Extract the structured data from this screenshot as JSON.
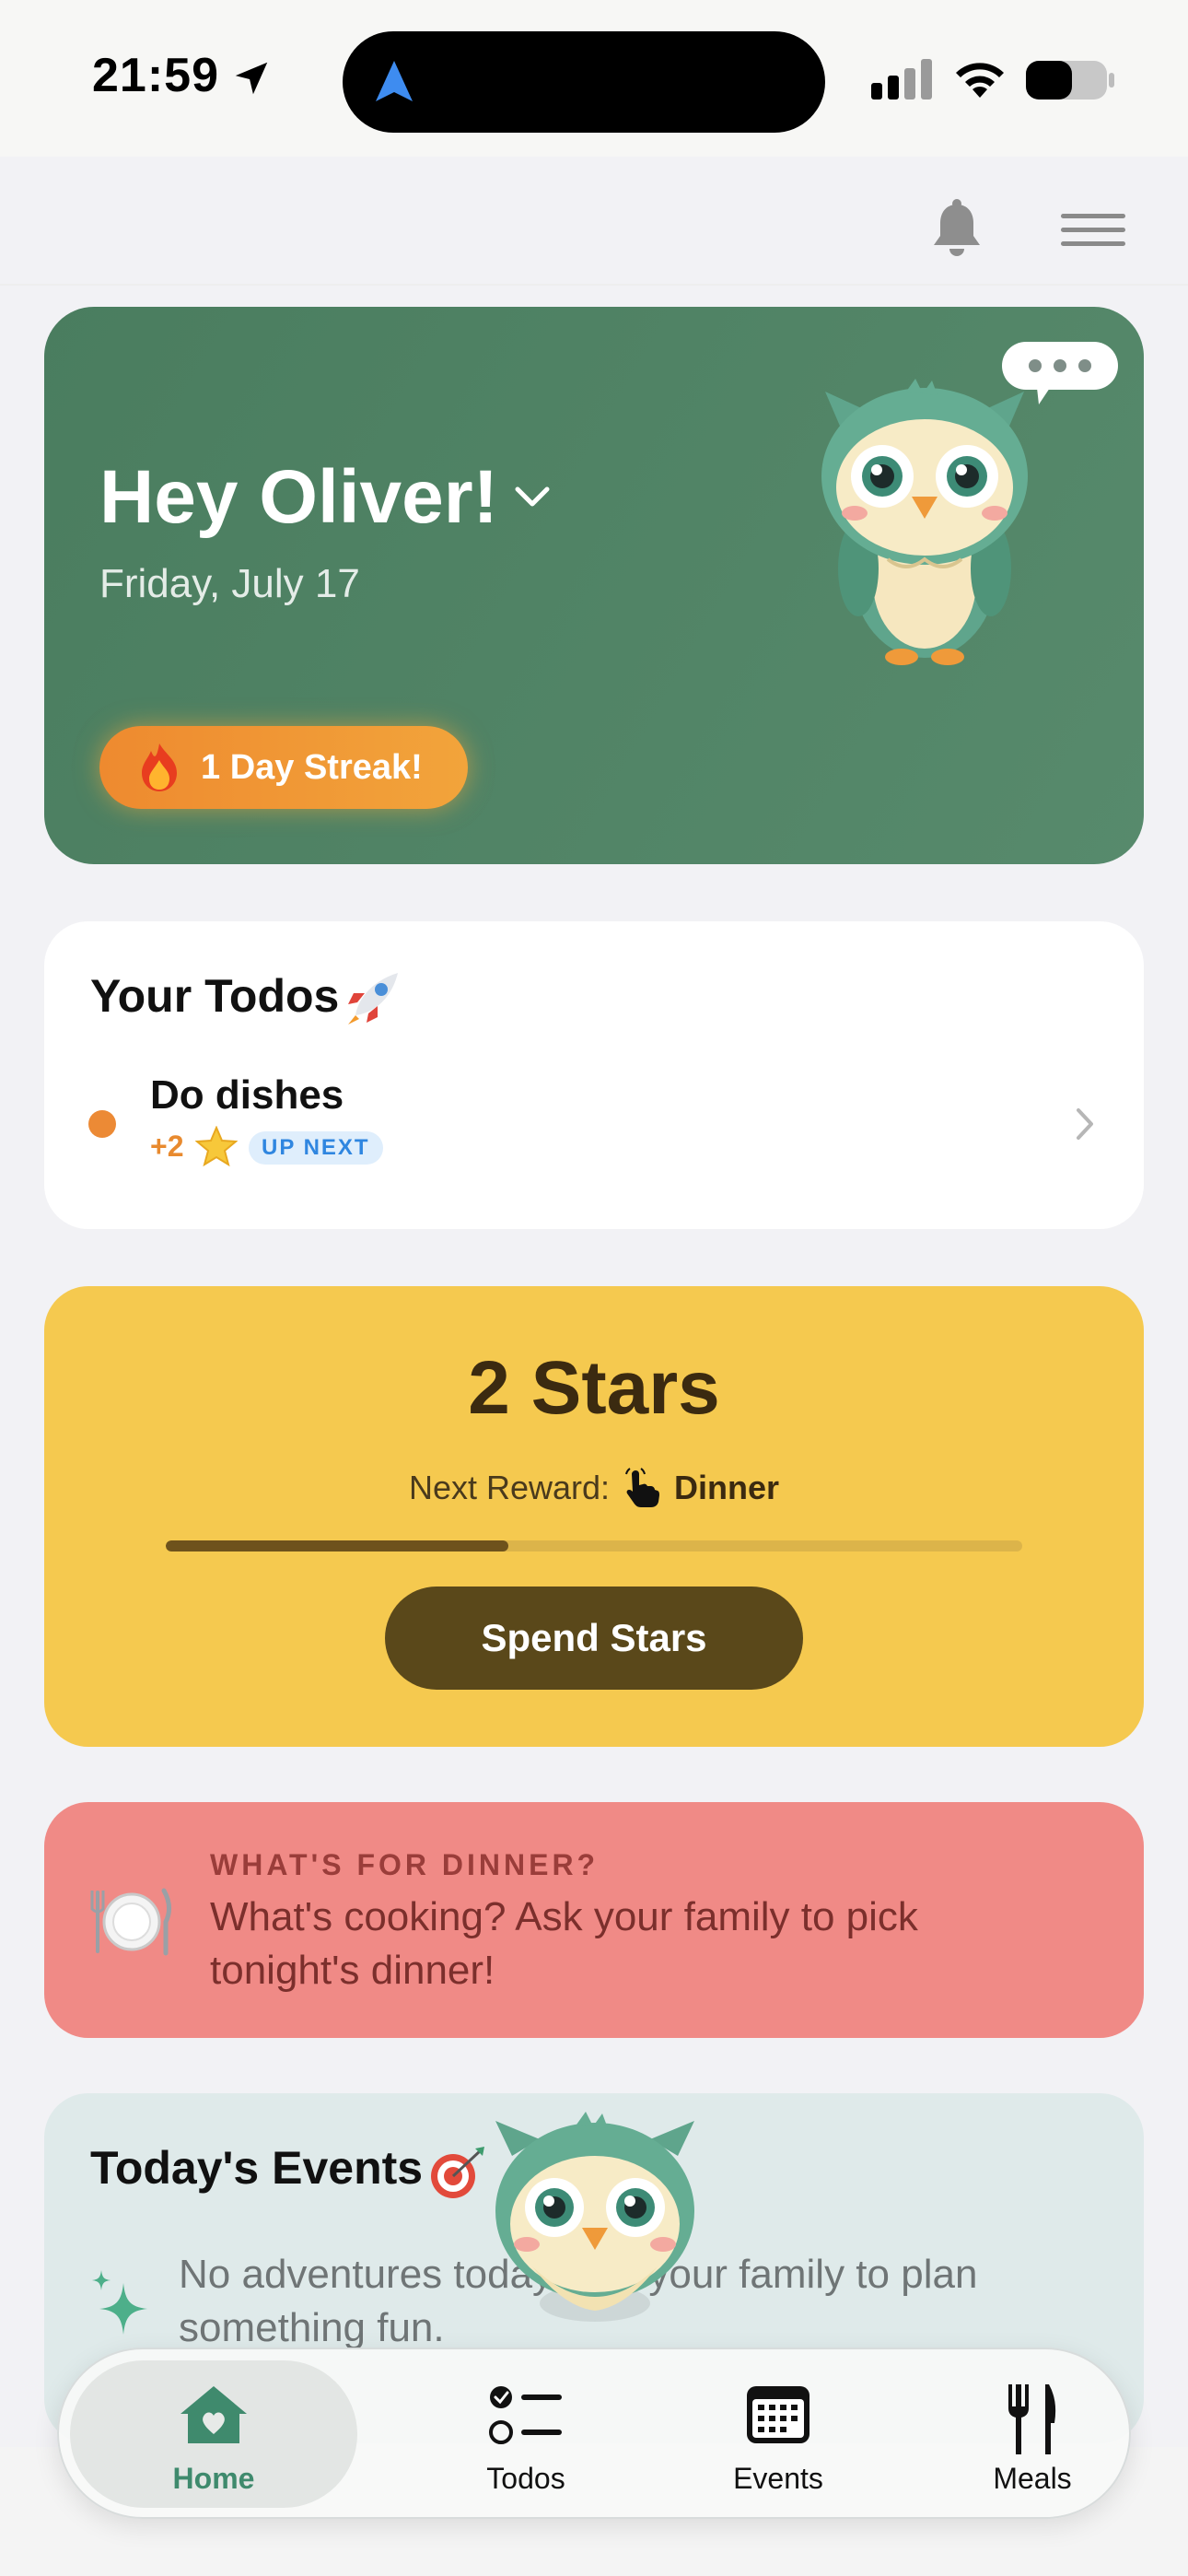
{
  "status_bar": {
    "time": "21:59",
    "icons": [
      "location-arrow-icon",
      "navigation-icon",
      "cellular-signal-icon",
      "wifi-icon",
      "battery-icon"
    ]
  },
  "header": {
    "icons": [
      "bell-icon",
      "menu-icon"
    ]
  },
  "hero": {
    "greeting": "Hey Oliver!",
    "date": "Friday, July 17",
    "streak": "1 Day Streak!",
    "colors": {
      "background": "#4a7d5f",
      "streak": "#ee8a2f"
    }
  },
  "todos": {
    "title": "Your Todos",
    "items": [
      {
        "name": "Do dishes",
        "points": "+2",
        "badge": "UP NEXT"
      }
    ]
  },
  "stars": {
    "count": "2 Stars",
    "next_reward_label": "Next Reward:",
    "next_reward": "Dinner",
    "progress_fraction": 0.4,
    "button": "Spend Stars",
    "colors": {
      "background": "#f5c94f",
      "button": "#5a481a"
    }
  },
  "dinner": {
    "kicker": "WHAT'S FOR DINNER?",
    "text": "What's cooking? Ask your family to pick tonight's dinner!",
    "colors": {
      "background": "#f08a86"
    }
  },
  "events": {
    "title": "Today's Events",
    "text": "No adventures today. Ask your family to plan something fun."
  },
  "tabs": [
    {
      "label": "Home",
      "icon": "home-heart-icon",
      "active": true
    },
    {
      "label": "Todos",
      "icon": "checklist-icon",
      "active": false
    },
    {
      "label": "Events",
      "icon": "calendar-icon",
      "active": false
    },
    {
      "label": "Meals",
      "icon": "fork-knife-icon",
      "active": false
    }
  ],
  "accent_color": "#3f8a6d"
}
